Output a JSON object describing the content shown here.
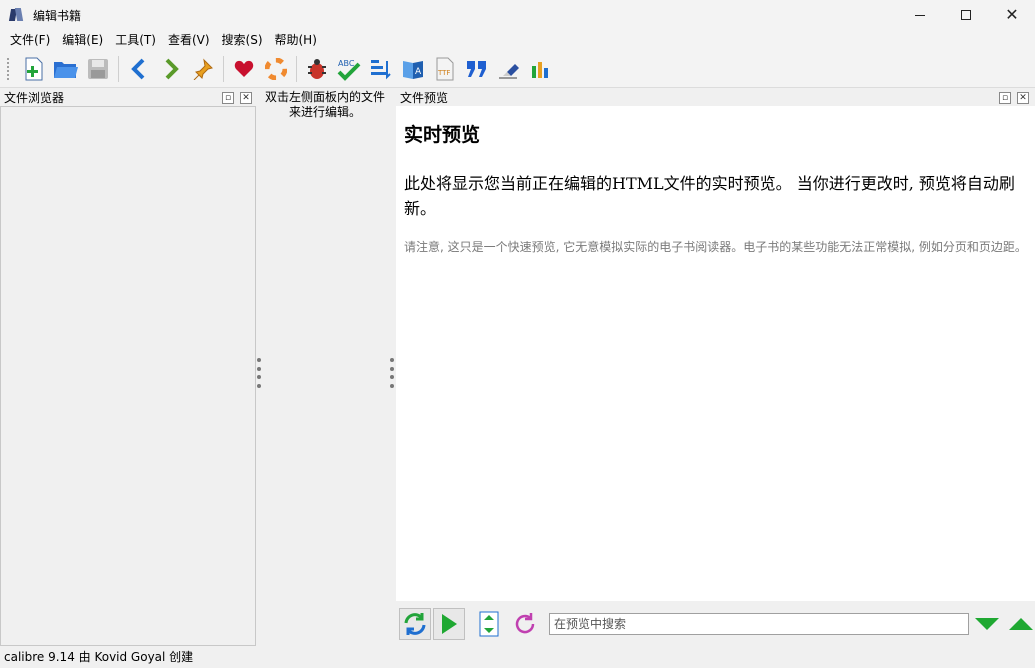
{
  "window": {
    "title": "编辑书籍"
  },
  "menu": [
    "文件(F)",
    "编辑(E)",
    "工具(T)",
    "查看(V)",
    "搜索(S)",
    "帮助(H)"
  ],
  "toolbar": {
    "icons": [
      "new-file-icon",
      "open-folder-icon",
      "save-icon",
      "back-arrow-icon",
      "forward-arrow-icon",
      "pin-icon",
      "heart-icon",
      "lifebuoy-icon",
      "bug-icon",
      "spellcheck-icon",
      "sort-icon",
      "translate-icon",
      "font-file-icon",
      "quote-icon",
      "eraser-icon",
      "reports-icon"
    ]
  },
  "file_browser": {
    "title": "文件浏览器"
  },
  "middle": {
    "message": "双击左侧面板内的文件来进行编辑。"
  },
  "preview": {
    "title": "文件预览",
    "heading": "实时预览",
    "paragraph1": "此处将显示您当前正在编辑的HTML文件的实时预览。 当你进行更改时, 预览将自动刷新。",
    "paragraph2": "请注意, 这只是一个快速预览, 它无意模拟实际的电子书阅读器。电子书的某些功能无法正常模拟, 例如分页和页边距。",
    "search_placeholder": "在预览中搜索"
  },
  "status": {
    "text": "calibre 9.14 由 Kovid Goyal 创建"
  },
  "colors": {
    "accent_green": "#1fa832",
    "toolbar_blue": "#1f6fd0"
  }
}
